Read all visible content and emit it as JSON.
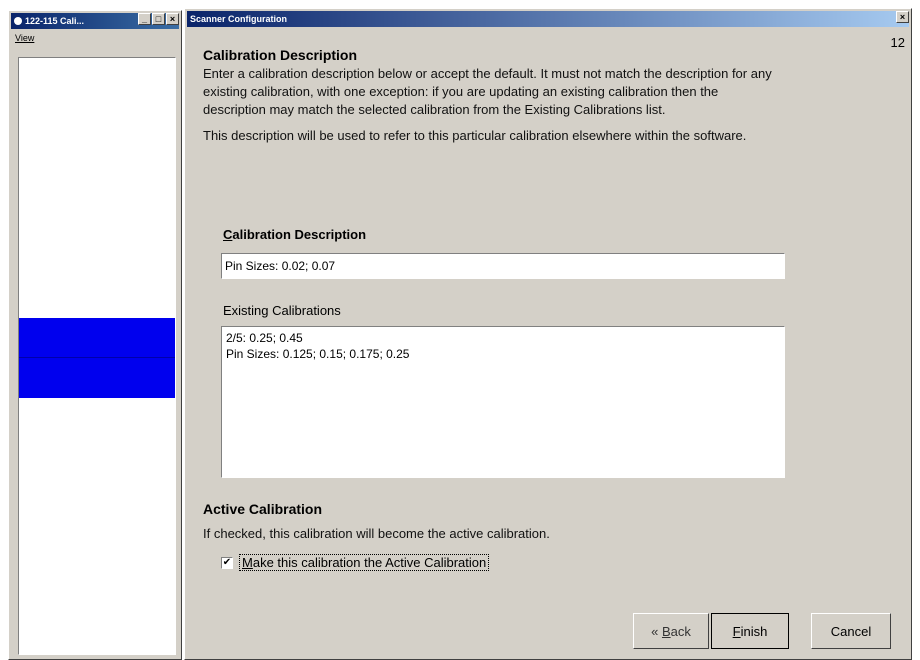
{
  "left_window": {
    "title": "122-115 Cali...",
    "menu": "View",
    "min_glyph": "_",
    "max_glyph": "□",
    "close_glyph": "×"
  },
  "dialog": {
    "title": "Scanner Configuration",
    "close_glyph": "×",
    "page_number": "12",
    "calib_section_title": "Calibration Description",
    "calib_para1": "Enter a calibration description below or accept the default.  It must not match the description for any existing calibration, with one exception: if you are updating an existing calibration then the description may match the selected calibration from the Existing Calibrations list.",
    "calib_para2": "This description will be used to refer to this particular calibration elsewhere within the software.",
    "desc_field_label_mnemonic": "C",
    "desc_field_label_rest": "alibration Description",
    "desc_field_value": "Pin Sizes: 0.02; 0.07",
    "existing_label": "Existing Calibrations",
    "existing_items": [
      "2/5: 0.25; 0.45",
      "Pin Sizes: 0.125; 0.15; 0.175; 0.25"
    ],
    "active_section_title": "Active Calibration",
    "active_desc": "If checked, this calibration will become the active calibration.",
    "checkbox_mark": "✔",
    "checkbox_label_mnemonic": "M",
    "checkbox_label_rest": "ake this calibration the Active Calibration",
    "buttons": {
      "back_prefix": "« ",
      "back_mnemonic": "B",
      "back_rest": "ack",
      "finish_mnemonic": "F",
      "finish_rest": "inish",
      "cancel": "Cancel"
    }
  }
}
